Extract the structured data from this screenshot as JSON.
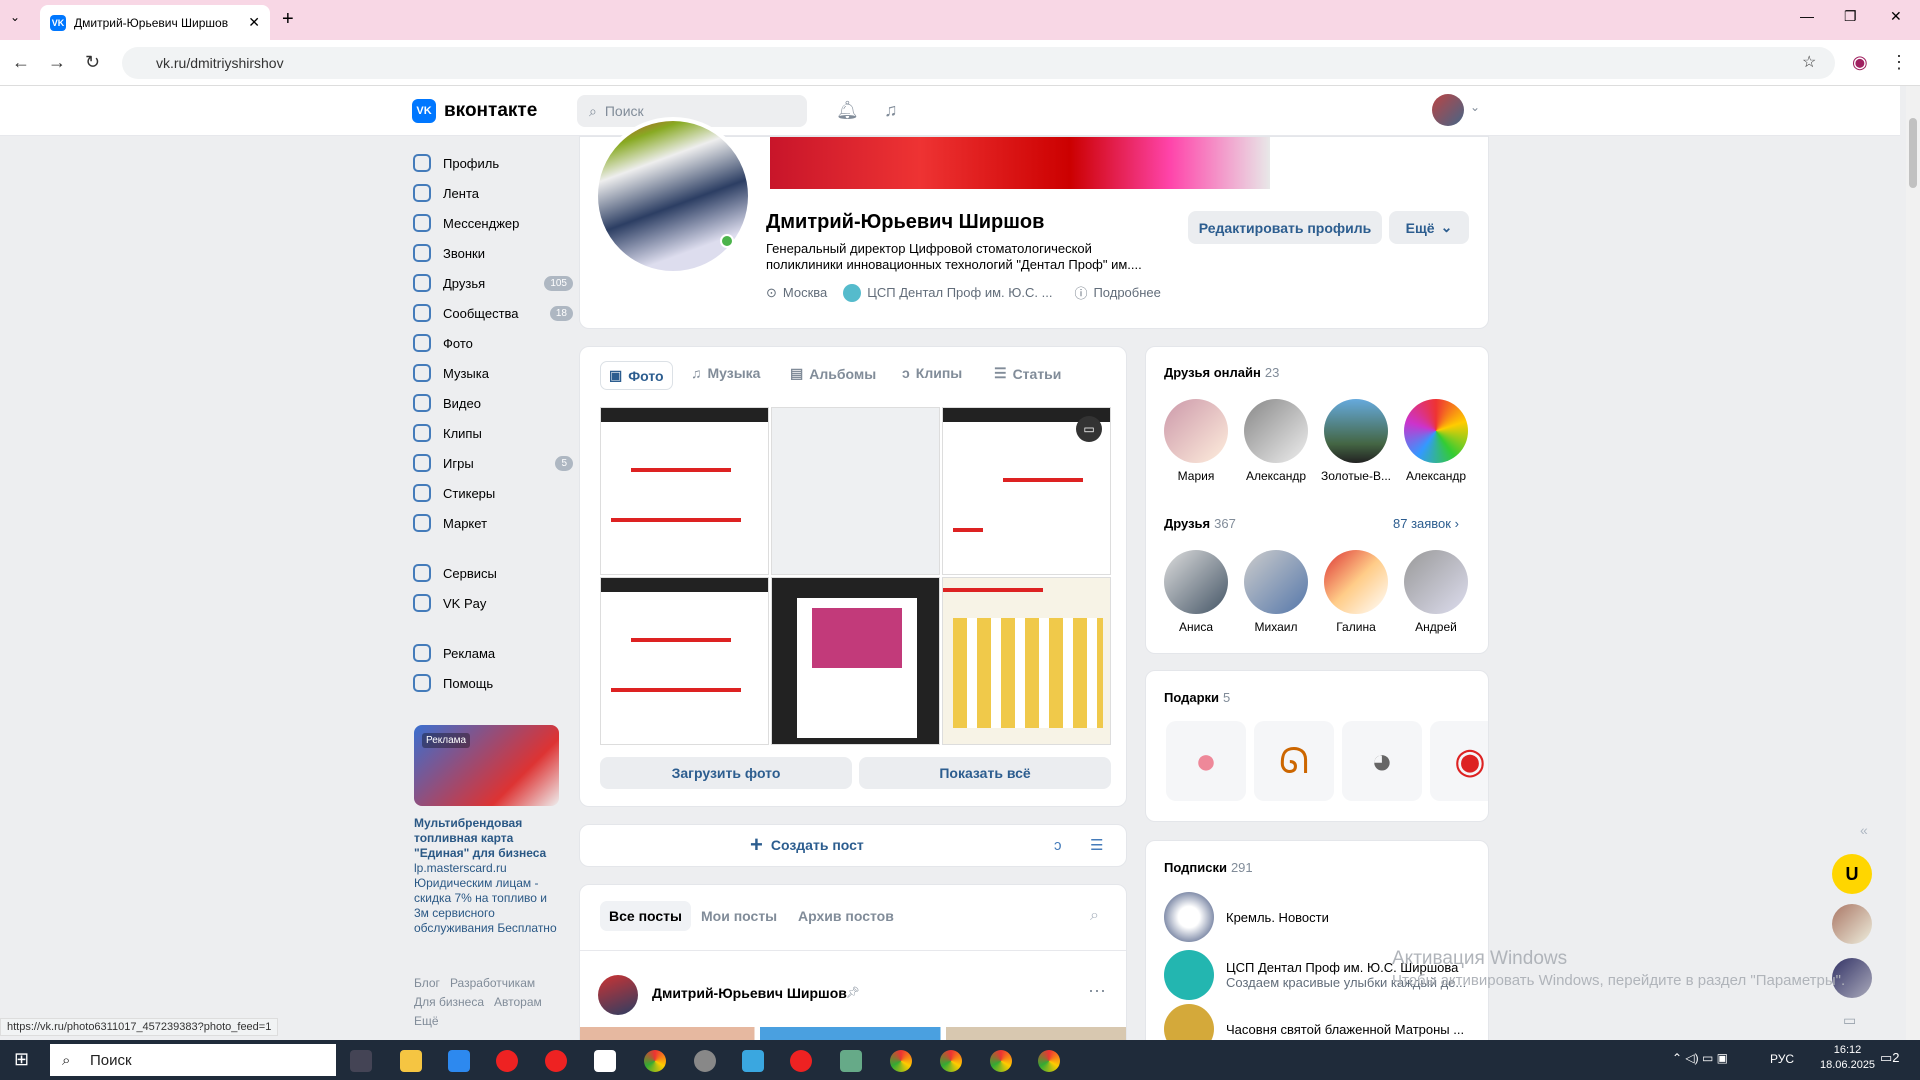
{
  "browser": {
    "tab_title": "Дмитрий-Юрьевич Ширшов",
    "url": "vk.ru/dmitriyshirshov",
    "status_url": "https://vk.ru/photo6311017_457239383?photo_feed=1"
  },
  "header": {
    "logo": "вконтакте",
    "search_placeholder": "Поиск"
  },
  "sidebar": {
    "items": [
      {
        "label": "Профиль"
      },
      {
        "label": "Лента"
      },
      {
        "label": "Мессенджер"
      },
      {
        "label": "Звонки"
      },
      {
        "label": "Друзья",
        "count": "105"
      },
      {
        "label": "Сообщества",
        "count": "18"
      },
      {
        "label": "Фото"
      },
      {
        "label": "Музыка"
      },
      {
        "label": "Видео"
      },
      {
        "label": "Клипы"
      },
      {
        "label": "Игры",
        "count": "5"
      },
      {
        "label": "Стикеры"
      },
      {
        "label": "Маркет"
      }
    ],
    "items2": [
      {
        "label": "Сервисы"
      },
      {
        "label": "VK Pay"
      }
    ],
    "items3": [
      {
        "label": "Реклама"
      },
      {
        "label": "Помощь"
      }
    ],
    "ad_badge": "Реклама",
    "ad_title": "Мультибрендовая топливная карта \"Единая\" для бизнеса",
    "ad_domain": "lp.masterscard.ru",
    "ad_text": "Юридическим лицам - скидка 7% на топливо и 3м сервисного обслуживания Бесплатно",
    "footer_links": [
      "Блог",
      "Разработчикам",
      "Для бизнеса",
      "Авторам",
      "Ещё"
    ]
  },
  "profile": {
    "name": "Дмитрий-Юрьевич Ширшов",
    "description": "Генеральный директор Цифровой стоматологической поликлиники инновационных технологий \"Дентал Проф\" им....",
    "city": "Москва",
    "work": "ЦСП Дентал Проф им. Ю.С. ...",
    "more": "Подробнее",
    "edit_button": "Редактировать профиль",
    "more_button": "Ещё"
  },
  "media_tabs": [
    "Фото",
    "Музыка",
    "Альбомы",
    "Клипы",
    "Статьи"
  ],
  "photo_buttons": {
    "upload": "Загрузить фото",
    "show_all": "Показать всё"
  },
  "create_post": "Создать пост",
  "post_tabs": [
    "Все посты",
    "Мои посты",
    "Архив постов"
  ],
  "post": {
    "author": "Дмитрий-Юрьевич Ширшов"
  },
  "friends_online": {
    "title": "Друзья онлайн",
    "count": "23",
    "people": [
      "Мария",
      "Александр",
      "Золотые-В...",
      "Александр"
    ]
  },
  "friends": {
    "title": "Друзья",
    "count": "367",
    "requests": "87 заявок",
    "people": [
      "Аниса",
      "Михаил",
      "Галина",
      "Андрей"
    ]
  },
  "gifts": {
    "title": "Подарки",
    "count": "5"
  },
  "subscriptions": {
    "title": "Подписки",
    "count": "291",
    "items": [
      {
        "name": "Кремль. Новости",
        "desc": ""
      },
      {
        "name": "ЦСП Дентал Проф им. Ю.С. Ширшова",
        "desc": "Создаем красивые улыбки каждый де..."
      },
      {
        "name": "Часовня святой блаженной Матроны ...",
        "desc": ""
      }
    ]
  },
  "windows": {
    "watermark_title": "Активация Windows",
    "watermark_text": "Чтобы активировать Windows, перейдите в раздел \"Параметры\".",
    "search": "Поиск",
    "lang": "РУС",
    "time": "16:12",
    "date": "18.06.2025",
    "notif": "2"
  }
}
